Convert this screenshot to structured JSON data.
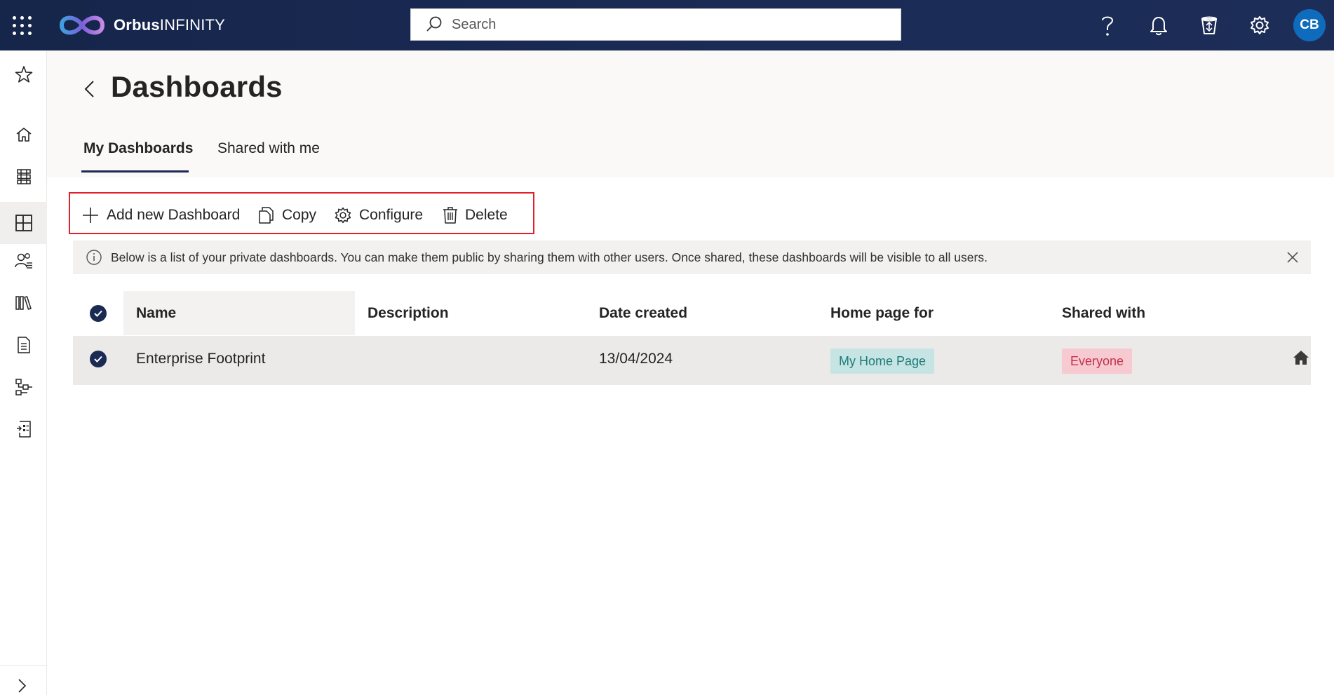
{
  "app": {
    "brand_bold": "Orbus",
    "brand_light": "INFINITY",
    "search_placeholder": "Search",
    "user_initials": "CB"
  },
  "topbar_icons": [
    "help-icon",
    "notification-bell-icon",
    "recycle-bin-icon",
    "settings-gear-icon"
  ],
  "rail": {
    "items": [
      "favorites-star-icon",
      "home-icon",
      "repository-icon",
      "dashboards-icon",
      "people-icon",
      "library-icon",
      "document-icon",
      "hierarchy-icon",
      "report-icon"
    ],
    "active": "dashboards-icon"
  },
  "page": {
    "title": "Dashboards",
    "tabs": [
      {
        "label": "My Dashboards",
        "selected": true
      },
      {
        "label": "Shared with me",
        "selected": false
      }
    ]
  },
  "toolbar": {
    "add_label": "Add new Dashboard",
    "copy_label": "Copy",
    "configure_label": "Configure",
    "delete_label": "Delete"
  },
  "info_message": "Below is a list of your private dashboards. You can make them public by sharing them with other users. Once shared, these dashboards will be visible to all users.",
  "table": {
    "columns": [
      "Name",
      "Description",
      "Date created",
      "Home page for",
      "Shared with"
    ],
    "rows": [
      {
        "name": "Enterprise Footprint",
        "description": "",
        "date_created": "13/04/2024",
        "home_page_for": "My Home Page",
        "shared_with": "Everyone",
        "selected": true
      }
    ]
  },
  "colors": {
    "topbar": "#1a2b55",
    "accent": "#1b2a52",
    "avatar": "#0f6cbd",
    "highlight_border": "#e0202a",
    "home_tag_bg": "#c6e4e4",
    "everyone_tag_bg": "#f7c9d1"
  }
}
